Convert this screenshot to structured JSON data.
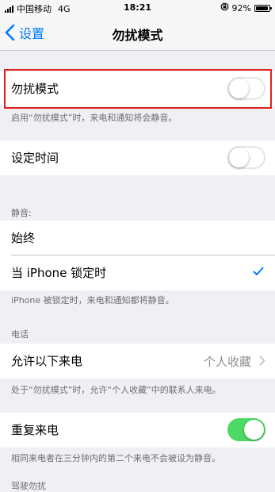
{
  "status_bar": {
    "carrier": "中国移动",
    "network": "4G",
    "time": "18:21",
    "battery": "92%",
    "battery_level": 0.92
  },
  "nav": {
    "back_label": "设置",
    "title": "勿扰模式"
  },
  "dnd": {
    "label": "勿扰模式",
    "enabled": false,
    "footer": "启用“勿扰模式”时，来电和通知将会静音。"
  },
  "scheduled": {
    "label": "设定时间",
    "enabled": false
  },
  "silence": {
    "header": "静音:",
    "options": [
      {
        "label": "始终",
        "selected": false
      },
      {
        "label": "当 iPhone 锁定时",
        "selected": true
      }
    ],
    "footer": "iPhone 被锁定时，来电和通知都将静音。"
  },
  "phone": {
    "header": "电话",
    "allow_calls": {
      "label": "允许以下来电",
      "value": "个人收藏"
    },
    "footer": "处于“勿扰模式”时，允许“个人收藏”中的联系人来电。"
  },
  "repeated": {
    "label": "重复来电",
    "enabled": true,
    "footer": "相同来电者在三分钟内的第二个来电不会被设为静音。"
  },
  "driving": {
    "header": "驾驶勿扰"
  },
  "colors": {
    "accent": "#007aff",
    "toggle_on": "#4cd964",
    "highlight": "#e02020"
  }
}
